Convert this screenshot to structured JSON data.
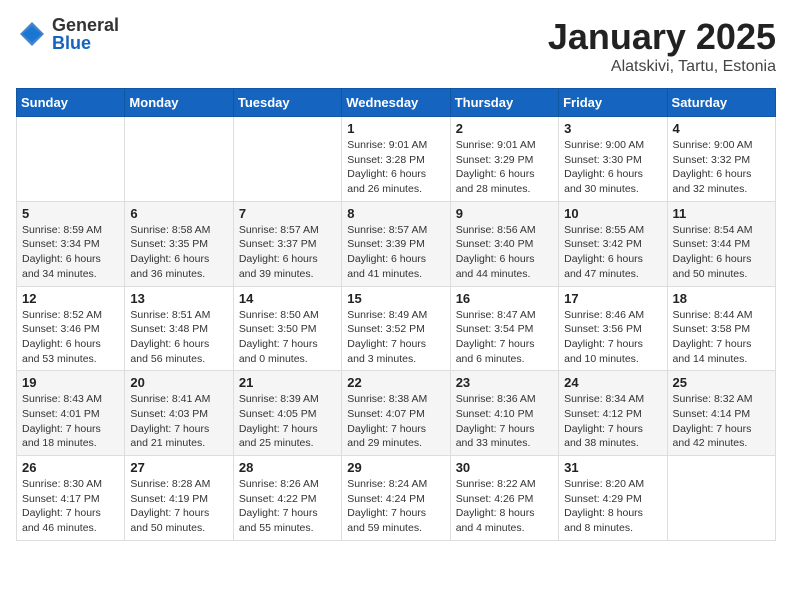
{
  "logo": {
    "general": "General",
    "blue": "Blue"
  },
  "title": "January 2025",
  "subtitle": "Alatskivi, Tartu, Estonia",
  "days_of_week": [
    "Sunday",
    "Monday",
    "Tuesday",
    "Wednesday",
    "Thursday",
    "Friday",
    "Saturday"
  ],
  "weeks": [
    [
      {
        "day": "",
        "info": ""
      },
      {
        "day": "",
        "info": ""
      },
      {
        "day": "",
        "info": ""
      },
      {
        "day": "1",
        "info": "Sunrise: 9:01 AM\nSunset: 3:28 PM\nDaylight: 6 hours\nand 26 minutes."
      },
      {
        "day": "2",
        "info": "Sunrise: 9:01 AM\nSunset: 3:29 PM\nDaylight: 6 hours\nand 28 minutes."
      },
      {
        "day": "3",
        "info": "Sunrise: 9:00 AM\nSunset: 3:30 PM\nDaylight: 6 hours\nand 30 minutes."
      },
      {
        "day": "4",
        "info": "Sunrise: 9:00 AM\nSunset: 3:32 PM\nDaylight: 6 hours\nand 32 minutes."
      }
    ],
    [
      {
        "day": "5",
        "info": "Sunrise: 8:59 AM\nSunset: 3:34 PM\nDaylight: 6 hours\nand 34 minutes."
      },
      {
        "day": "6",
        "info": "Sunrise: 8:58 AM\nSunset: 3:35 PM\nDaylight: 6 hours\nand 36 minutes."
      },
      {
        "day": "7",
        "info": "Sunrise: 8:57 AM\nSunset: 3:37 PM\nDaylight: 6 hours\nand 39 minutes."
      },
      {
        "day": "8",
        "info": "Sunrise: 8:57 AM\nSunset: 3:39 PM\nDaylight: 6 hours\nand 41 minutes."
      },
      {
        "day": "9",
        "info": "Sunrise: 8:56 AM\nSunset: 3:40 PM\nDaylight: 6 hours\nand 44 minutes."
      },
      {
        "day": "10",
        "info": "Sunrise: 8:55 AM\nSunset: 3:42 PM\nDaylight: 6 hours\nand 47 minutes."
      },
      {
        "day": "11",
        "info": "Sunrise: 8:54 AM\nSunset: 3:44 PM\nDaylight: 6 hours\nand 50 minutes."
      }
    ],
    [
      {
        "day": "12",
        "info": "Sunrise: 8:52 AM\nSunset: 3:46 PM\nDaylight: 6 hours\nand 53 minutes."
      },
      {
        "day": "13",
        "info": "Sunrise: 8:51 AM\nSunset: 3:48 PM\nDaylight: 6 hours\nand 56 minutes."
      },
      {
        "day": "14",
        "info": "Sunrise: 8:50 AM\nSunset: 3:50 PM\nDaylight: 7 hours\nand 0 minutes."
      },
      {
        "day": "15",
        "info": "Sunrise: 8:49 AM\nSunset: 3:52 PM\nDaylight: 7 hours\nand 3 minutes."
      },
      {
        "day": "16",
        "info": "Sunrise: 8:47 AM\nSunset: 3:54 PM\nDaylight: 7 hours\nand 6 minutes."
      },
      {
        "day": "17",
        "info": "Sunrise: 8:46 AM\nSunset: 3:56 PM\nDaylight: 7 hours\nand 10 minutes."
      },
      {
        "day": "18",
        "info": "Sunrise: 8:44 AM\nSunset: 3:58 PM\nDaylight: 7 hours\nand 14 minutes."
      }
    ],
    [
      {
        "day": "19",
        "info": "Sunrise: 8:43 AM\nSunset: 4:01 PM\nDaylight: 7 hours\nand 18 minutes."
      },
      {
        "day": "20",
        "info": "Sunrise: 8:41 AM\nSunset: 4:03 PM\nDaylight: 7 hours\nand 21 minutes."
      },
      {
        "day": "21",
        "info": "Sunrise: 8:39 AM\nSunset: 4:05 PM\nDaylight: 7 hours\nand 25 minutes."
      },
      {
        "day": "22",
        "info": "Sunrise: 8:38 AM\nSunset: 4:07 PM\nDaylight: 7 hours\nand 29 minutes."
      },
      {
        "day": "23",
        "info": "Sunrise: 8:36 AM\nSunset: 4:10 PM\nDaylight: 7 hours\nand 33 minutes."
      },
      {
        "day": "24",
        "info": "Sunrise: 8:34 AM\nSunset: 4:12 PM\nDaylight: 7 hours\nand 38 minutes."
      },
      {
        "day": "25",
        "info": "Sunrise: 8:32 AM\nSunset: 4:14 PM\nDaylight: 7 hours\nand 42 minutes."
      }
    ],
    [
      {
        "day": "26",
        "info": "Sunrise: 8:30 AM\nSunset: 4:17 PM\nDaylight: 7 hours\nand 46 minutes."
      },
      {
        "day": "27",
        "info": "Sunrise: 8:28 AM\nSunset: 4:19 PM\nDaylight: 7 hours\nand 50 minutes."
      },
      {
        "day": "28",
        "info": "Sunrise: 8:26 AM\nSunset: 4:22 PM\nDaylight: 7 hours\nand 55 minutes."
      },
      {
        "day": "29",
        "info": "Sunrise: 8:24 AM\nSunset: 4:24 PM\nDaylight: 7 hours\nand 59 minutes."
      },
      {
        "day": "30",
        "info": "Sunrise: 8:22 AM\nSunset: 4:26 PM\nDaylight: 8 hours\nand 4 minutes."
      },
      {
        "day": "31",
        "info": "Sunrise: 8:20 AM\nSunset: 4:29 PM\nDaylight: 8 hours\nand 8 minutes."
      },
      {
        "day": "",
        "info": ""
      }
    ]
  ]
}
